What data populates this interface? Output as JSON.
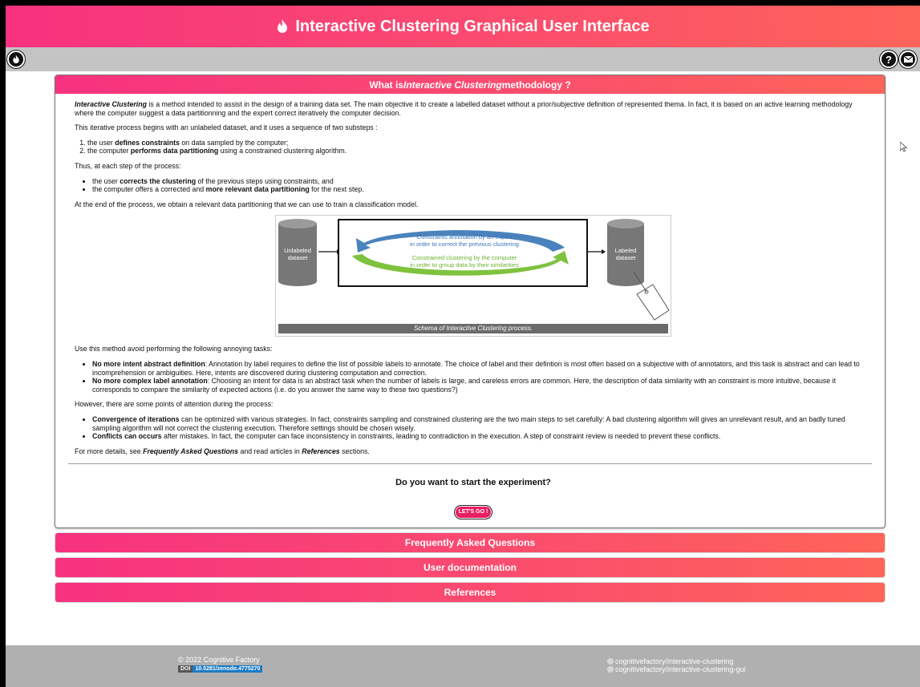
{
  "app": {
    "title": "Interactive Clustering Graphical User Interface"
  },
  "intro_card": {
    "title_pre": "What is ",
    "title_em": "Interactive Clustering",
    "title_post": " methodology ?",
    "p1_em": "Interactive Clustering",
    "p1_rest": " is a method intended to assist in the design of a training data set. The main objective it to create a labelled dataset without a prior/subjective definition of represented thema. In fact, it is based on an active learning methodology where the computer suggest a data partitionning and the expert correct iteratively the computer decision.",
    "p2": "This iterative process begins with an unlabeled dataset, and it uses a sequence of two substeps :",
    "steps": [
      {
        "pre": "the user ",
        "bold": "defines constraints",
        "post": " on data sampled by the computer;"
      },
      {
        "pre": "the computer ",
        "bold": "performs data partitioning",
        "post": " using a constrained clustering algorithm."
      }
    ],
    "p3": "Thus, at each step of the process:",
    "thus": [
      {
        "pre": "the user ",
        "bold": "corrects the clustering",
        "post": " of the previous steps using constraints, and"
      },
      {
        "pre": "the computer offers a corrected and ",
        "bold": "more relevant data partitioning",
        "post": " for the next step."
      }
    ],
    "p4": "At the end of the process, we obtain a relevant data partitioning that we can use to train a classification model.",
    "schema": {
      "unlabeled_1": "Unlabeled",
      "unlabeled_2": "dataset",
      "labeled_1": "Labeled",
      "labeled_2": "dataset",
      "blue_1": "Constraints annotation by an expert",
      "blue_2": "in order to correct the previous clustering",
      "green_1": "Constrained clustering by the computer",
      "green_2": "in order to group data by their similarities",
      "caption": "Schema of Interactive Clustering process."
    },
    "p5": "Use this method avoid performing the following annoying tasks:",
    "avoid": [
      {
        "bold": "No more intent abstract definition",
        "rest": ": Annotation by label requires to define the list of possible labels to annotate. The choice of label and their defintion is most often based on a subjective with of annotators, and this task is abstract and can lead to incomprehension or ambiguities. Here, intents are discovered during clustering computation and correction."
      },
      {
        "bold": "No more complex label annotation",
        "rest": ": Choosing an intent for data is an abstract task when the number of labels is large, and careless errors are common. Here, the description of data similarity with an constraint is more intuitive, because it corresponds to compare the similarity of expected actions (i.e. do you answer the same way to these two questions?)"
      }
    ],
    "p6": "However, there are some points of attention during the process:",
    "attention": [
      {
        "bold": "Convergence of iterations",
        "rest": " can be optimized with various strategies. In fact, constraints sampling and constrained clustering are the two main steps to set carefully: A bad clustering algorithm will gives an unrelevant result, and an badly tuned sampling algorithm will not correct the clustering execution. Therefore settings should be chosen wisely."
      },
      {
        "bold": "Conflicts can occurs",
        "rest": " after mistakes. In fact, the computer can face inconsistency in constraints, leading to contradiction in the execution. A step of constraint review is needed to prevent these conflicts."
      }
    ],
    "p7_pre": "For more details, see ",
    "p7_faq": "Frequently Asked Questions",
    "p7_mid": " and read articles in ",
    "p7_ref": "References",
    "p7_post": " sections.",
    "cta_question": "Do you want to start the experiment?",
    "cta_button": "LET'S GO !"
  },
  "accordions": [
    "Frequently Asked Questions",
    "User documentation",
    "References"
  ],
  "footer": {
    "copyright": "© 2022 Cognitive Factory",
    "doi_label": "DOI",
    "doi_value": "10.5281/zenodo.4775270",
    "repo_1": "cognitivefactory/interactive-clustering",
    "repo_2": "cognitivefactory/interactive-clustering-gui"
  },
  "icons": {
    "brand": "flame-icon",
    "help": "question-circle-icon",
    "contact": "envelope-icon"
  },
  "colors": {
    "gradient_start": "#f7317f",
    "gradient_end": "#fe6459",
    "toolbar": "#c4c4c4",
    "footer": "#b0b0b0"
  }
}
